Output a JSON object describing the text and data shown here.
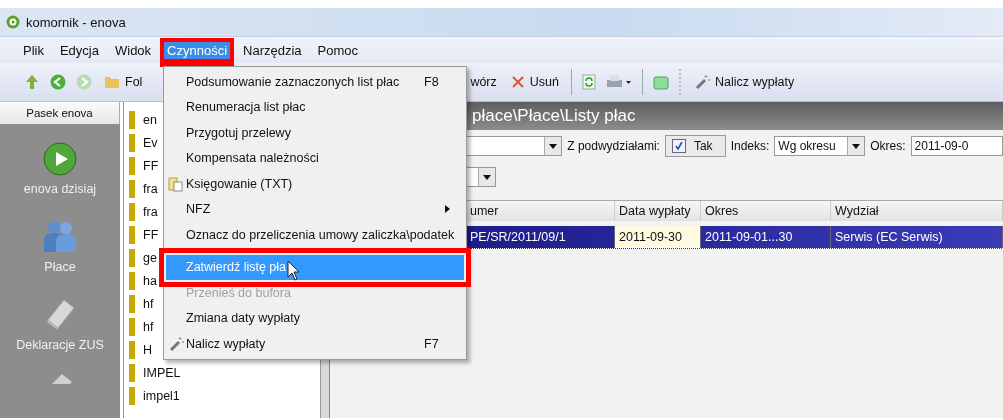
{
  "window": {
    "title": "komornik - enova"
  },
  "menubar": [
    {
      "label": "Plik",
      "selected": false,
      "highlighted": false
    },
    {
      "label": "Edycja",
      "selected": false,
      "highlighted": false
    },
    {
      "label": "Widok",
      "selected": false,
      "highlighted": false
    },
    {
      "label": "Czynności",
      "selected": true,
      "highlighted": true
    },
    {
      "label": "Narzędzia",
      "selected": false,
      "highlighted": false
    },
    {
      "label": "Pomoc",
      "selected": false,
      "highlighted": false
    }
  ],
  "toolbar": {
    "folder_label": "Fol",
    "create_label": "wórz",
    "delete_label": "Usuń",
    "calc_label": "Nalicz wypłaty"
  },
  "sidebar": {
    "header": "Pasek enova",
    "items": [
      {
        "label": "enova dzisiaj",
        "kind": "play"
      },
      {
        "label": "Płace",
        "kind": "people"
      },
      {
        "label": "Deklaracje ZUS",
        "kind": "book"
      }
    ]
  },
  "folders": [
    "en",
    "Ev",
    "FF",
    "fra",
    "fra",
    "FF",
    "ge",
    "ha",
    "hf",
    "hf",
    "H",
    "IMPEL",
    "impel1"
  ],
  "menu": [
    {
      "kind": "item",
      "label": "Podsumowanie zaznaczonych list płac",
      "shortcut": "F8",
      "selected": false,
      "disabled": false,
      "highlighted": false
    },
    {
      "kind": "item",
      "label": "Renumeracja list płac",
      "selected": false,
      "disabled": false,
      "highlighted": false
    },
    {
      "kind": "item",
      "label": "Przygotuj przelewy",
      "selected": false,
      "disabled": false,
      "highlighted": false
    },
    {
      "kind": "item",
      "label": "Kompensata należności",
      "selected": false,
      "disabled": false,
      "highlighted": false
    },
    {
      "kind": "ledger",
      "label": "Księgowanie (TXT)",
      "selected": false,
      "disabled": false,
      "highlighted": false
    },
    {
      "kind": "submenu",
      "label": "NFZ",
      "selected": false,
      "disabled": false,
      "highlighted": false
    },
    {
      "kind": "item",
      "label": "Oznacz do przeliczenia umowy zaliczka\\podatek",
      "selected": false,
      "disabled": false,
      "highlighted": false
    },
    {
      "kind": "separator"
    },
    {
      "kind": "item",
      "label": "Zatwierdź listę pła",
      "selected": true,
      "disabled": false,
      "highlighted": true
    },
    {
      "kind": "item",
      "label": "Przenieś do bufora",
      "selected": false,
      "disabled": true,
      "highlighted": false
    },
    {
      "kind": "item",
      "label": "Zmiana daty wypłaty",
      "selected": false,
      "disabled": false,
      "highlighted": false
    },
    {
      "kind": "wizard",
      "label": "Nalicz wypłaty",
      "shortcut": "F7",
      "selected": false,
      "disabled": false,
      "highlighted": false
    }
  ],
  "panel": {
    "path": "płace\\Płace\\Listy płac",
    "subdivisions_label": "Z podwydziałami:",
    "subdivisions_checked": true,
    "subdivisions_value": "Tak",
    "index_label": "Indeks:",
    "index_value": "Wg okresu",
    "period_label": "Okres:",
    "period_value": "2011-09-0"
  },
  "table": {
    "columns": [
      "umer",
      "Data wypłaty",
      "Okres",
      "Wydział"
    ],
    "rows": [
      {
        "cells": [
          "PE/SR/2011/09/1",
          "2011-09-30",
          "2011-09-01...30",
          "Serwis (EC Serwis)"
        ],
        "selected": true
      }
    ]
  }
}
